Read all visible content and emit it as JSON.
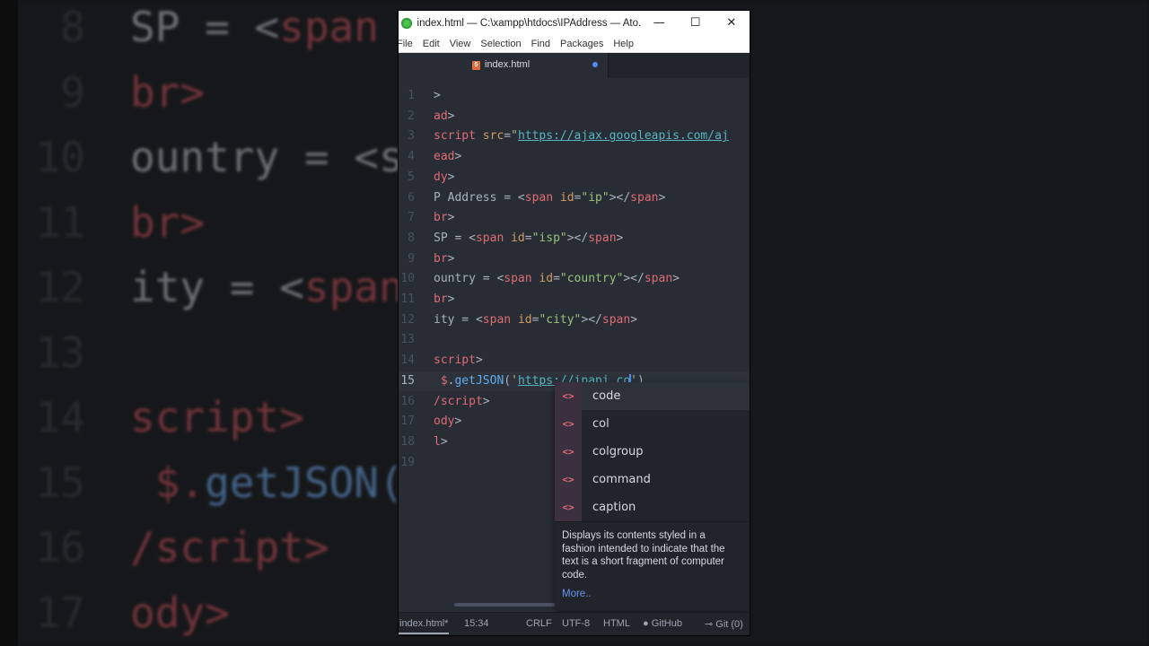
{
  "background": {
    "lines": [
      {
        "num": "8",
        "parts": [
          [
            "wht",
            "SP = <"
          ],
          [
            "red",
            "span"
          ]
        ]
      },
      {
        "num": "9",
        "parts": [
          [
            "red",
            "br>"
          ]
        ]
      },
      {
        "num": "10",
        "parts": [
          [
            "wht",
            "ountry = <s"
          ]
        ]
      },
      {
        "num": "11",
        "parts": [
          [
            "red",
            "br>"
          ]
        ]
      },
      {
        "num": "12",
        "parts": [
          [
            "wht",
            "ity = <"
          ],
          [
            "red",
            "span"
          ]
        ]
      },
      {
        "num": "13",
        "parts": []
      },
      {
        "num": "14",
        "parts": [
          [
            "red",
            "script>"
          ]
        ]
      },
      {
        "num": "15",
        "parts": [
          [
            "red",
            " $."
          ],
          [
            "blu",
            "getJSON("
          ]
        ]
      },
      {
        "num": "16",
        "parts": [
          [
            "red",
            "/script>"
          ]
        ]
      },
      {
        "num": "17",
        "parts": [
          [
            "red",
            "ody>"
          ]
        ]
      }
    ]
  },
  "window": {
    "title": "index.html — C:\\xampp\\htdocs\\IPAddress — Ato...",
    "minimize": "—",
    "maximize": "☐",
    "close": "✕"
  },
  "menu": [
    "File",
    "Edit",
    "View",
    "Selection",
    "Find",
    "Packages",
    "Help"
  ],
  "tab": {
    "label": "index.html",
    "icon": "5"
  },
  "editor": {
    "current_line": 15,
    "lines": [
      {
        "num": "1",
        "parts": [
          [
            "txt",
            ">"
          ]
        ]
      },
      {
        "num": "2",
        "parts": [
          [
            "red",
            "ad"
          ],
          [
            "txt",
            ">"
          ]
        ]
      },
      {
        "num": "3",
        "parts": [
          [
            "red",
            "script"
          ],
          [
            "txt",
            " "
          ],
          [
            "org",
            "src"
          ],
          [
            "txt",
            "="
          ],
          [
            "str",
            "\""
          ],
          [
            "url",
            "https://ajax.googleapis.com/aj"
          ]
        ]
      },
      {
        "num": "4",
        "parts": [
          [
            "red",
            "ead"
          ],
          [
            "txt",
            ">"
          ]
        ]
      },
      {
        "num": "5",
        "parts": [
          [
            "red",
            "dy"
          ],
          [
            "txt",
            ">"
          ]
        ]
      },
      {
        "num": "6",
        "parts": [
          [
            "txt",
            "P Address = <"
          ],
          [
            "red",
            "span"
          ],
          [
            "txt",
            " "
          ],
          [
            "org",
            "id"
          ],
          [
            "txt",
            "="
          ],
          [
            "str",
            "\"ip\""
          ],
          [
            "txt",
            "></"
          ],
          [
            "red",
            "span"
          ],
          [
            "txt",
            ">"
          ]
        ]
      },
      {
        "num": "7",
        "parts": [
          [
            "red",
            "br"
          ],
          [
            "txt",
            ">"
          ]
        ]
      },
      {
        "num": "8",
        "parts": [
          [
            "txt",
            "SP = <"
          ],
          [
            "red",
            "span"
          ],
          [
            "txt",
            " "
          ],
          [
            "org",
            "id"
          ],
          [
            "txt",
            "="
          ],
          [
            "str",
            "\"isp\""
          ],
          [
            "txt",
            "></"
          ],
          [
            "red",
            "span"
          ],
          [
            "txt",
            ">"
          ]
        ]
      },
      {
        "num": "9",
        "parts": [
          [
            "red",
            "br"
          ],
          [
            "txt",
            ">"
          ]
        ]
      },
      {
        "num": "10",
        "parts": [
          [
            "txt",
            "ountry = <"
          ],
          [
            "red",
            "span"
          ],
          [
            "txt",
            " "
          ],
          [
            "org",
            "id"
          ],
          [
            "txt",
            "="
          ],
          [
            "str",
            "\"country\""
          ],
          [
            "txt",
            "></"
          ],
          [
            "red",
            "span"
          ],
          [
            "txt",
            ">"
          ]
        ]
      },
      {
        "num": "11",
        "parts": [
          [
            "red",
            "br"
          ],
          [
            "txt",
            ">"
          ]
        ]
      },
      {
        "num": "12",
        "parts": [
          [
            "txt",
            "ity = <"
          ],
          [
            "red",
            "span"
          ],
          [
            "txt",
            " "
          ],
          [
            "org",
            "id"
          ],
          [
            "txt",
            "="
          ],
          [
            "str",
            "\"city\""
          ],
          [
            "txt",
            "></"
          ],
          [
            "red",
            "span"
          ],
          [
            "txt",
            ">"
          ]
        ]
      },
      {
        "num": "13",
        "parts": []
      },
      {
        "num": "14",
        "parts": [
          [
            "red",
            "script"
          ],
          [
            "txt",
            ">"
          ]
        ]
      },
      {
        "num": "15",
        "parts": [
          [
            "txt",
            " "
          ],
          [
            "red",
            "$"
          ],
          [
            "txt",
            "."
          ],
          [
            "blu",
            "getJSON"
          ],
          [
            "txt",
            "("
          ],
          [
            "str",
            "'"
          ],
          [
            "url",
            "https://ipapi.co"
          ],
          [
            "cursor",
            ""
          ],
          [
            "str",
            "'"
          ],
          [
            "txt",
            ")"
          ]
        ]
      },
      {
        "num": "16",
        "parts": [
          [
            "red",
            "/script"
          ],
          [
            "txt",
            ">"
          ]
        ]
      },
      {
        "num": "17",
        "parts": [
          [
            "red",
            "ody"
          ],
          [
            "txt",
            ">"
          ]
        ]
      },
      {
        "num": "18",
        "parts": [
          [
            "red",
            "l"
          ],
          [
            "txt",
            ">"
          ]
        ]
      },
      {
        "num": "19",
        "parts": []
      }
    ]
  },
  "autocomplete": {
    "icon": "<>",
    "items": [
      "code",
      "col",
      "colgroup",
      "command",
      "caption"
    ],
    "selected_index": 0,
    "description": "Displays its contents styled in a fashion intended to indicate that the text is a short fragment of computer code.",
    "more": "More.."
  },
  "status": {
    "file": "index.html*",
    "position": "15:34",
    "line_ending": "CRLF",
    "encoding": "UTF-8",
    "grammar": "HTML",
    "github": "GitHub",
    "git": "Git (0)"
  }
}
